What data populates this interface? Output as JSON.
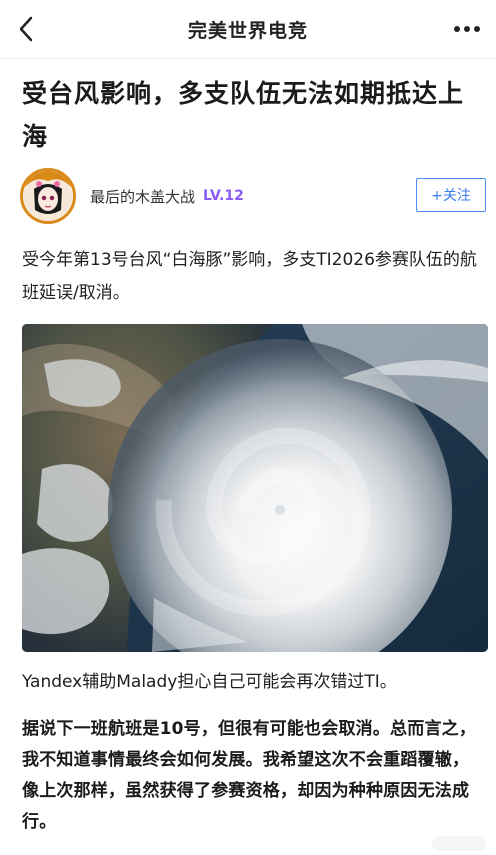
{
  "header": {
    "title": "完美世界电竞",
    "back_icon": "chevron-left-icon",
    "more_icon": "more-horizontal-icon"
  },
  "article": {
    "title": "受台风影响，多支队伍无法如期抵达上海",
    "author": {
      "name": "最后的木盖大战",
      "level": "LV.12",
      "follow_label": "+关注"
    },
    "paragraph_1": "受今年第13号台风“白海豚”影响，多支TI2026参赛队伍的航班延误/取消。",
    "image_caption": "Yandex辅助Malady担心自己可能会再次错过TI。",
    "paragraph_2": "据说下一班航班是10号，但很有可能也会取消。总而言之，我不知道事情最终会如何发展。我希望这次不会重蹈覆辙，像上次那样，虽然获得了参赛资格，却因为种种原因无法成行。"
  },
  "colors": {
    "level": "#8a5cf5",
    "follow": "#3a7df0",
    "avatar_ring": "#d88a18"
  }
}
